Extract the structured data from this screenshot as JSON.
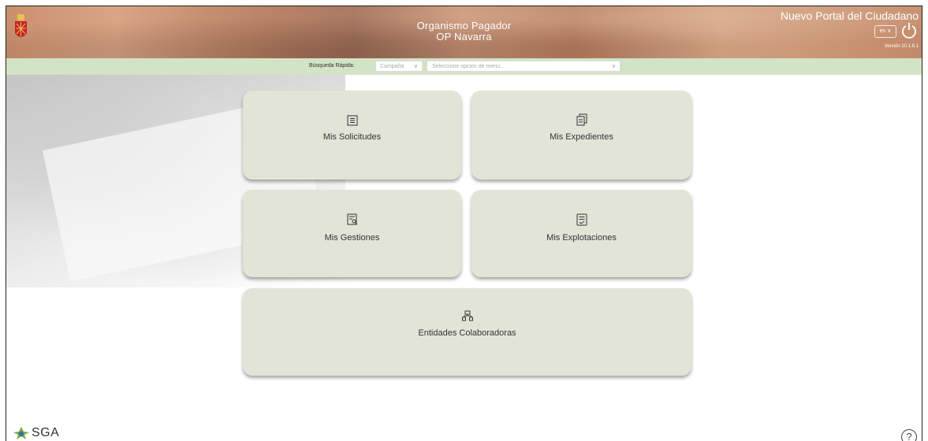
{
  "header": {
    "org_line1": "Organismo Pagador",
    "org_line2": "OP Navarra",
    "portal_title": "Nuevo Portal del Ciudadano",
    "language": "es",
    "version": "Versión 10.1.8.1"
  },
  "quick_search": {
    "label": "Búsqueda Rápida:",
    "campaign_placeholder": "Campaña",
    "menu_placeholder": "Seleccione opción de menú..."
  },
  "tiles": [
    {
      "label": "Mis Solicitudes",
      "icon": "list-icon"
    },
    {
      "label": "Mis Expedientes",
      "icon": "copy-documents-icon"
    },
    {
      "label": "Mis Gestiones",
      "icon": "document-search-icon"
    },
    {
      "label": "Mis Explotaciones",
      "icon": "document-lines-icon"
    },
    {
      "label": "Entidades Colaboradoras",
      "icon": "hierarchy-icon"
    }
  ],
  "footer": {
    "logo_text": "SGA",
    "help_symbol": "?"
  },
  "colors": {
    "header_bg": "#c28a69",
    "search_bar_bg": "#d3e3c5",
    "tile_bg": "#e2e4d8"
  }
}
